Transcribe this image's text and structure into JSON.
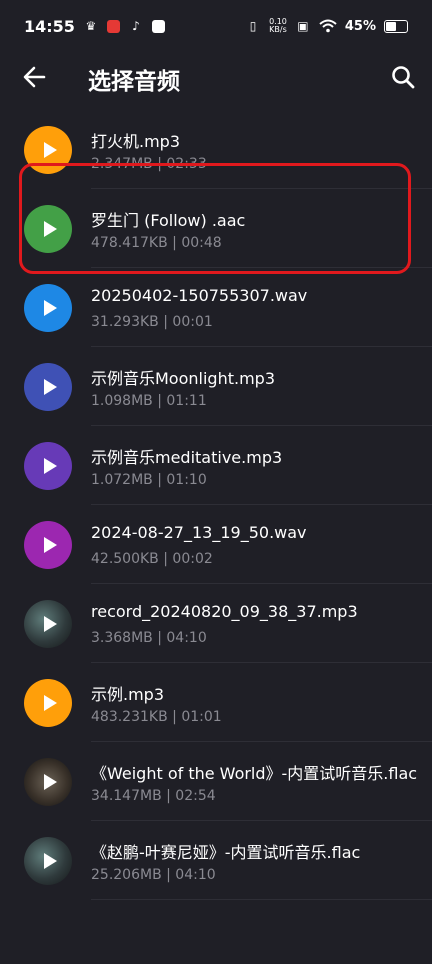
{
  "status_bar": {
    "time": "14:55",
    "net_speed_value": "0.10",
    "net_speed_unit": "KB/s",
    "battery": "45%"
  },
  "app_bar": {
    "title": "选择音频"
  },
  "tracks": [
    {
      "name": "打火机.mp3",
      "size": "2.347MB",
      "duration": "02:33",
      "color": "#ff9f0a",
      "type": "play"
    },
    {
      "name": "罗生门 (Follow) .aac",
      "size": "478.417KB",
      "duration": "00:48",
      "color": "#43a047",
      "type": "play",
      "highlighted": true
    },
    {
      "name": "20250402-150755307.wav",
      "size": "31.293KB",
      "duration": "00:01",
      "color": "#1e88e5",
      "type": "play"
    },
    {
      "name": "示例音乐Moonlight.mp3",
      "size": "1.098MB",
      "duration": "01:11",
      "color": "#3f51b5",
      "type": "play"
    },
    {
      "name": "示例音乐meditative.mp3",
      "size": "1.072MB",
      "duration": "01:10",
      "color": "#673ab7",
      "type": "play"
    },
    {
      "name": "2024-08-27_13_19_50.wav",
      "size": "42.500KB",
      "duration": "00:02",
      "color": "#9c27b0",
      "type": "play"
    },
    {
      "name": "record_20240820_09_38_37.mp3",
      "size": "3.368MB",
      "duration": "04:10",
      "color": "#3b4a4c",
      "type": "album"
    },
    {
      "name": "示例.mp3",
      "size": "483.231KB",
      "duration": "01:01",
      "color": "#ff9f0a",
      "type": "play"
    },
    {
      "name": "《Weight of the World》-内置试听音乐.flac",
      "size": "34.147MB",
      "duration": "02:54",
      "color": "#4a4036",
      "type": "album2"
    },
    {
      "name": "《赵鹏-叶赛尼娅》-内置试听音乐.flac",
      "size": "25.206MB",
      "duration": "04:10",
      "color": "#3b4a4c",
      "type": "album"
    }
  ],
  "colors": {
    "background": "#1f1f26",
    "highlight_border": "#e0191d",
    "meta_text": "#8a8a92"
  }
}
